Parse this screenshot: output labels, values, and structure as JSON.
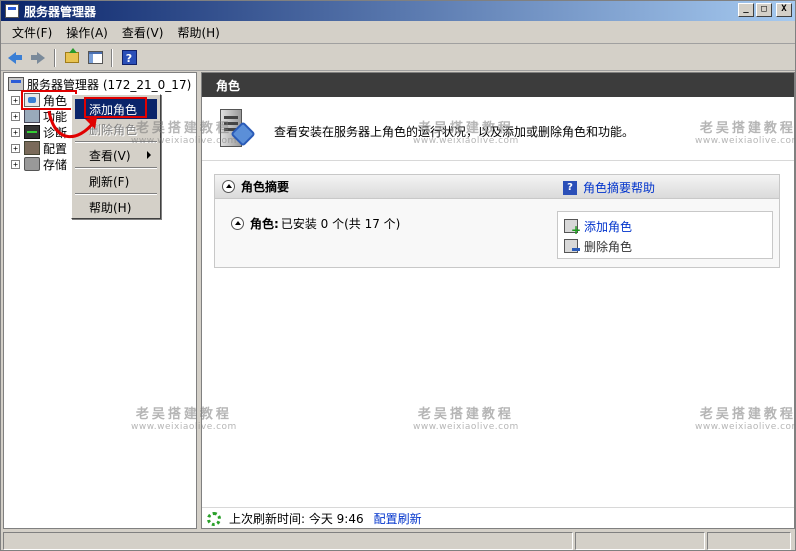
{
  "window": {
    "title": "服务器管理器"
  },
  "titlebar": {
    "minimize": "_",
    "maximize": "□",
    "close": "X"
  },
  "menu": [
    "文件(F)",
    "操作(A)",
    "查看(V)",
    "帮助(H)"
  ],
  "toolbar": {
    "help_glyph": "?"
  },
  "tree": {
    "root": "服务器管理器 (172_21_0_17)",
    "items": [
      {
        "label": "角色",
        "icon": "roles-icon"
      },
      {
        "label": "功能",
        "icon": "features-icon"
      },
      {
        "label": "诊断",
        "icon": "diagnostics-icon"
      },
      {
        "label": "配置",
        "icon": "configuration-icon"
      },
      {
        "label": "存储",
        "icon": "storage-icon"
      }
    ],
    "expander": "+"
  },
  "context_menu": {
    "items": [
      {
        "label": "添加角色"
      },
      {
        "label": "删除角色"
      },
      {
        "label": "查看(V)"
      },
      {
        "label": "刷新(F)"
      },
      {
        "label": "帮助(H)"
      }
    ]
  },
  "content": {
    "header": "角色",
    "intro": "查看安装在服务器上角色的运行状况，以及添加或删除角色和功能。",
    "summary": {
      "title": "角色摘要",
      "help_link": "角色摘要帮助",
      "roles_label": "角色:",
      "roles_status": "已安装 0 个(共 17 个)",
      "tasks": {
        "add": "添加角色",
        "remove": "删除角色"
      }
    },
    "refresh": {
      "text": "上次刷新时间: 今天 9:46",
      "link": "配置刷新"
    }
  },
  "watermark": {
    "title": "老吴搭建教程",
    "url": "www.weixiaolive.com"
  },
  "colors": {
    "highlight": "#e00000",
    "link": "#0033cc",
    "header": "#3c3c3c",
    "selection": "#0a246a"
  }
}
